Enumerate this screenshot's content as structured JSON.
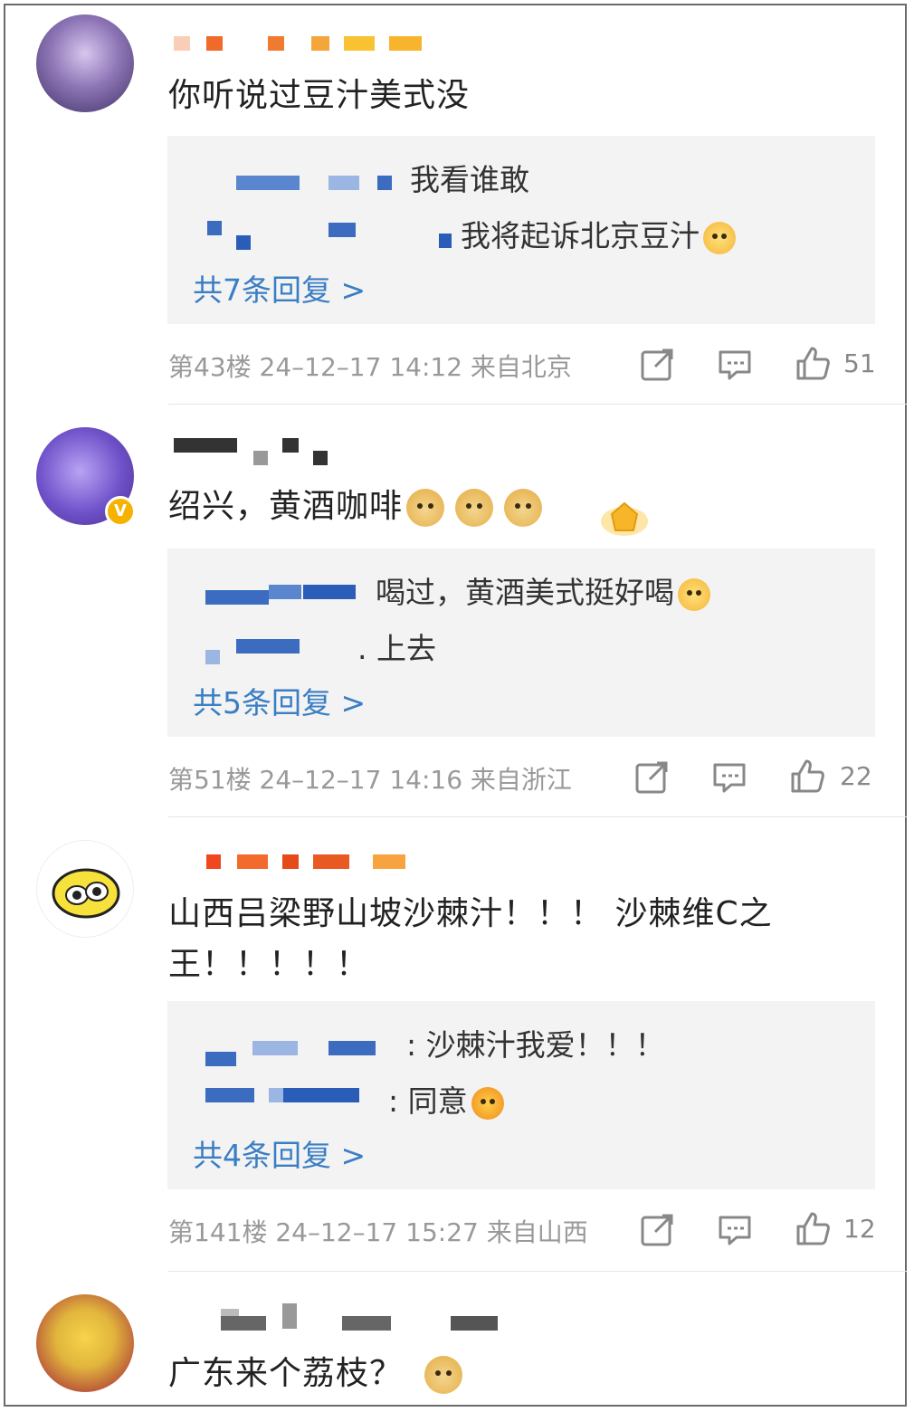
{
  "comments": [
    {
      "text": "你听说过豆汁美式没",
      "replies": [
        {
          "text": "我看谁敢"
        },
        {
          "text": "我将起诉北京豆汁"
        }
      ],
      "more_replies": "共7条回复 >",
      "meta": "第43楼 24–12–17 14:12 来自北京",
      "likes": "51"
    },
    {
      "text": "绍兴，黄酒咖啡",
      "replies": [
        {
          "text": "喝过，黄酒美式挺好喝"
        },
        {
          "text": ". 上去"
        }
      ],
      "more_replies": "共5条回复 >",
      "meta": "第51楼 24–12–17 14:16 来自浙江",
      "likes": "22"
    },
    {
      "text": "山西吕梁野山坡沙棘汁！！！ 沙棘维C之王！！！！！",
      "replies": [
        {
          "text": ": 沙棘汁我爱！！！"
        },
        {
          "text": ": 同意"
        }
      ],
      "more_replies": "共4条回复 >",
      "meta": "第141楼 24–12–17 15:27 来自山西",
      "likes": "12"
    },
    {
      "text": "广东来个荔枝？"
    }
  ],
  "icons": {
    "share": "share-icon",
    "comment": "comment-icon",
    "like": "thumbs-up-icon",
    "verified": "verified-badge-icon"
  },
  "colors": {
    "link": "#3a7ec4",
    "meta": "#999999",
    "reply_bg": "#f3f3f3",
    "badge": "#f5b300"
  }
}
